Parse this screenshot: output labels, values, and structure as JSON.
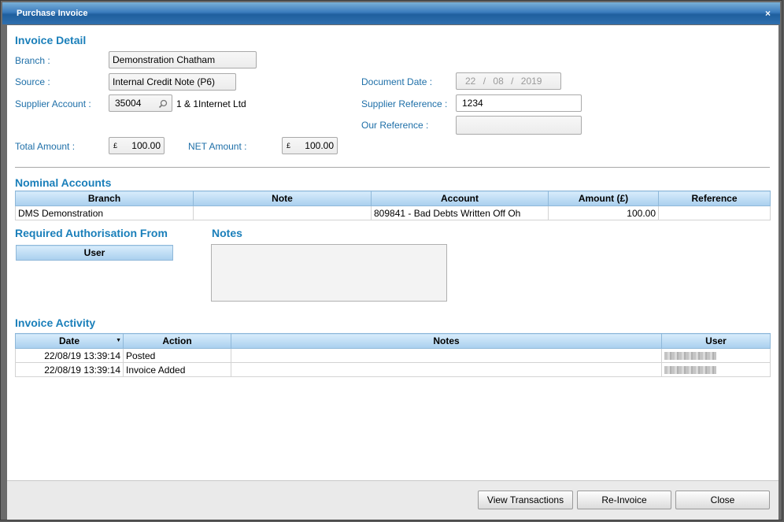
{
  "window": {
    "title": "Purchase Invoice",
    "close": "×"
  },
  "invoice_detail": {
    "heading": "Invoice Detail",
    "branch_label": "Branch :",
    "branch_value": "Demonstration Chatham",
    "source_label": "Source :",
    "source_value": "Internal Credit Note (P6)",
    "supplier_account_label": "Supplier Account :",
    "supplier_account_value": "35004",
    "supplier_name": "1 & 1Internet Ltd",
    "total_amount_label": "Total Amount :",
    "total_amount_currency": "£",
    "total_amount_value": "100.00",
    "net_amount_label": "NET Amount :",
    "net_amount_currency": "£",
    "net_amount_value": "100.00",
    "document_date_label": "Document Date :",
    "document_date": {
      "day": "22",
      "month": "08",
      "year": "2019",
      "sep": "/"
    },
    "supplier_reference_label": "Supplier Reference :",
    "supplier_reference_value": "1234",
    "our_reference_label": "Our Reference :",
    "our_reference_value": ""
  },
  "nominal_accounts": {
    "heading": "Nominal Accounts",
    "columns": [
      "Branch",
      "Note",
      "Account",
      "Amount (£)",
      "Reference"
    ],
    "rows": [
      [
        "DMS Demonstration",
        "",
        "809841 - Bad Debts Written Off Oh",
        "100.00",
        ""
      ]
    ]
  },
  "authorisation": {
    "heading": "Required Authorisation From",
    "column": "User"
  },
  "notes": {
    "heading": "Notes",
    "value": ""
  },
  "invoice_activity": {
    "heading": "Invoice Activity",
    "columns": [
      "Date",
      "Action",
      "Notes",
      "User"
    ],
    "rows": [
      [
        "22/08/19 13:39:14",
        "Posted",
        "",
        ""
      ],
      [
        "22/08/19 13:39:14",
        "Invoice Added",
        "",
        ""
      ]
    ]
  },
  "footer": {
    "view_transactions": "View Transactions",
    "re_invoice": "Re-Invoice",
    "close": "Close"
  },
  "icons": {
    "lookup": "magnifier-icon",
    "sort": "sort-desc-icon"
  }
}
